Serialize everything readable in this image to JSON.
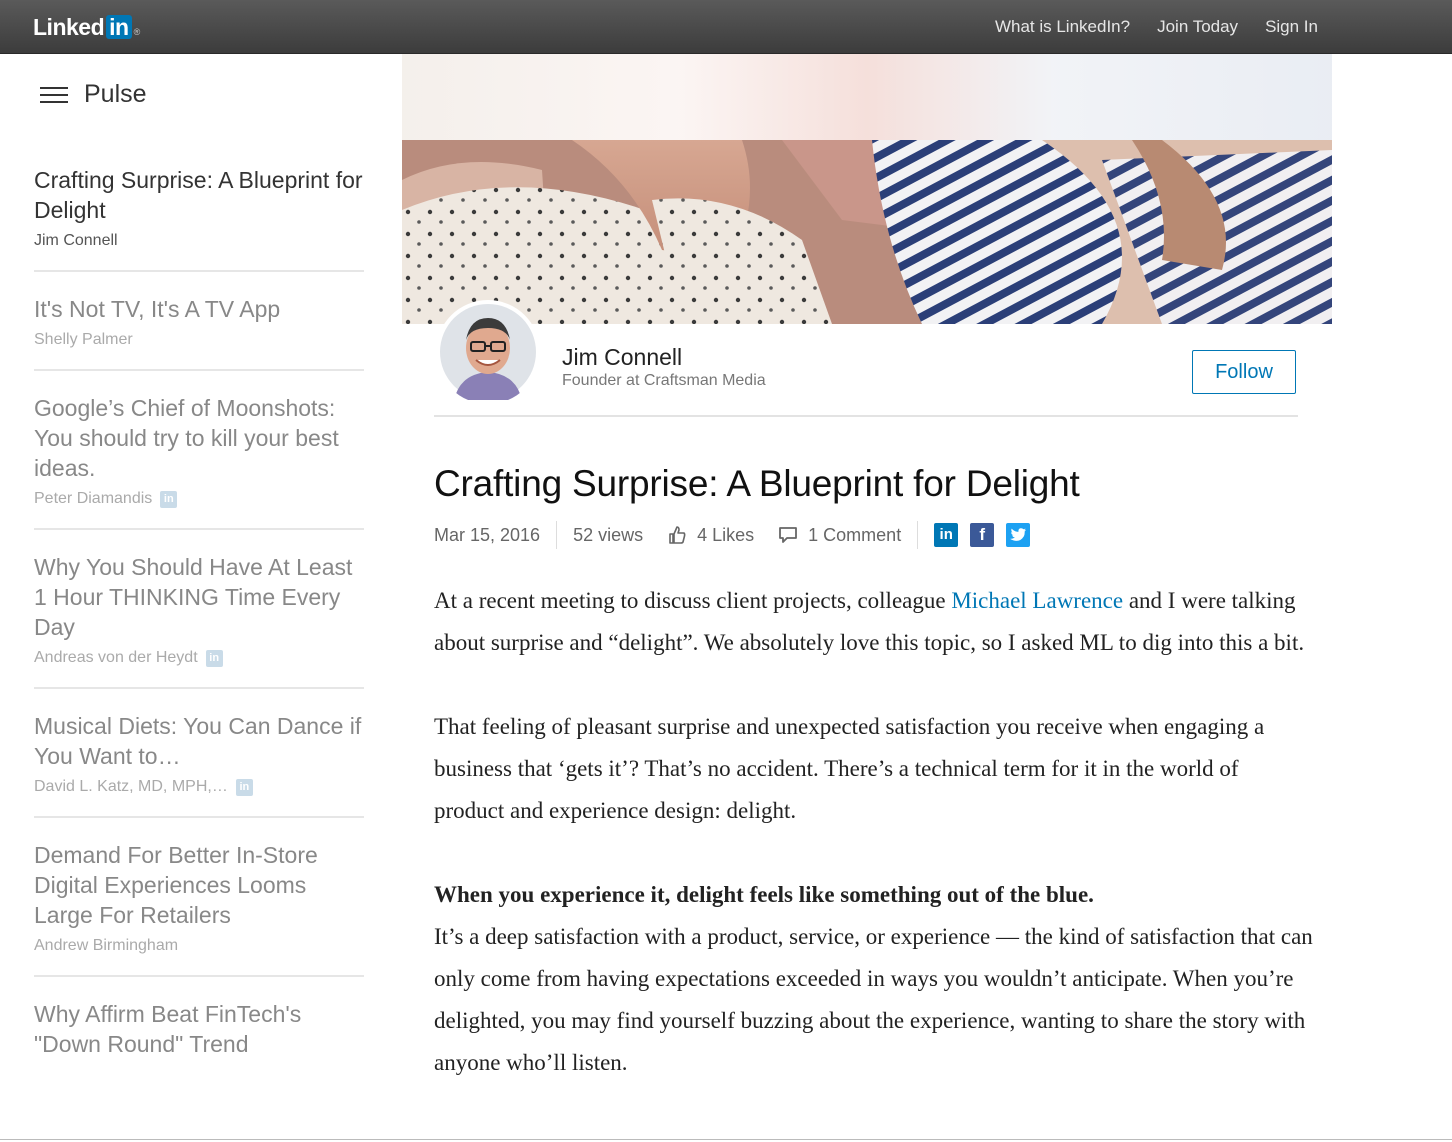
{
  "topbar": {
    "logo_text": "Linked",
    "logo_in": "in",
    "logo_reg": "®",
    "nav": [
      {
        "label": "What is LinkedIn?"
      },
      {
        "label": "Join Today"
      },
      {
        "label": "Sign In"
      }
    ]
  },
  "sidebar": {
    "heading": "Pulse",
    "items": [
      {
        "title": "Crafting Surprise: A Blueprint for Delight",
        "author": "Jim Connell",
        "influencer": false,
        "active": true
      },
      {
        "title": "It's Not TV, It's A TV App",
        "author": "Shelly Palmer",
        "influencer": false,
        "active": false
      },
      {
        "title": "Google’s Chief of Moonshots: You should try to kill your best ideas.",
        "author": "Peter Diamandis",
        "influencer": true,
        "active": false
      },
      {
        "title": "Why You Should Have At Least 1 Hour THINKING Time Every Day",
        "author": "Andreas von der Heydt",
        "influencer": true,
        "active": false
      },
      {
        "title": "Musical Diets: You Can Dance if You Want to…",
        "author": "David L. Katz, MD, MPH,…",
        "influencer": true,
        "active": false
      },
      {
        "title": "Demand For Better In-Store Digital Experiences Looms Large For Retailers",
        "author": "Andrew Birmingham",
        "influencer": false,
        "active": false
      },
      {
        "title": "Why Affirm Beat FinTech's \"Down Round\" Trend",
        "author": "",
        "influencer": false,
        "active": false
      }
    ],
    "influencer_badge": "in"
  },
  "author": {
    "name": "Jim Connell",
    "role": "Founder at Craftsman Media",
    "follow_label": "Follow"
  },
  "article": {
    "title": "Crafting Surprise: A Blueprint for Delight",
    "date": "Mar 15, 2016",
    "views": "52 views",
    "likes": "4 Likes",
    "comments": "1 Comment",
    "share": {
      "linkedin": "in",
      "facebook": "f",
      "twitter": "t"
    },
    "p1_before": "At a recent meeting to discuss client projects, colleague ",
    "p1_link": "Michael Lawrence",
    "p1_after": " and I were talking about surprise and “delight”. We absolutely love this topic, so I asked ML to dig into this a bit.",
    "p2": "That feeling of pleasant surprise and unexpected satisfaction you receive when engaging a business that ‘gets it’? That’s no accident. There’s a technical term for it in the world of product and experience design: delight.",
    "p3_bold": "When you experience it, delight feels like something out of the blue.",
    "p4": "It’s a deep satisfaction with a product, service, or experience — the kind of satisfaction that can only come from having expectations exceeded in ways you wouldn’t anticipate. When you’re delighted, you may find yourself buzzing about the experience, wanting to share the story with anyone who’ll listen."
  }
}
